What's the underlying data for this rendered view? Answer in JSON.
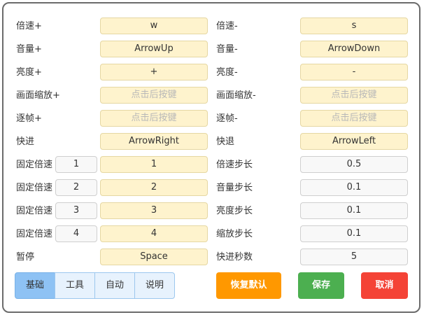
{
  "left_rows": [
    {
      "label": "倍速+",
      "key": "w",
      "placeholder": false
    },
    {
      "label": "音量+",
      "key": "ArrowUp",
      "placeholder": false
    },
    {
      "label": "亮度+",
      "key": "+",
      "placeholder": false
    },
    {
      "label": "画面缩放+",
      "key": "点击后按键",
      "placeholder": true
    },
    {
      "label": "逐帧+",
      "key": "点击后按键",
      "placeholder": true
    },
    {
      "label": "快进",
      "key": "ArrowRight",
      "placeholder": false
    },
    {
      "label": "固定倍速",
      "num": "1",
      "key": "1",
      "placeholder": false
    },
    {
      "label": "固定倍速",
      "num": "2",
      "key": "2",
      "placeholder": false
    },
    {
      "label": "固定倍速",
      "num": "3",
      "key": "3",
      "placeholder": false
    },
    {
      "label": "固定倍速",
      "num": "4",
      "key": "4",
      "placeholder": false
    },
    {
      "label": "暂停",
      "key": "Space",
      "placeholder": false
    }
  ],
  "right_rows": [
    {
      "label": "倍速-",
      "value": "s",
      "style": "yellow",
      "placeholder": false
    },
    {
      "label": "音量-",
      "value": "ArrowDown",
      "style": "yellow",
      "placeholder": false
    },
    {
      "label": "亮度-",
      "value": "-",
      "style": "yellow",
      "placeholder": false
    },
    {
      "label": "画面缩放-",
      "value": "点击后按键",
      "style": "yellow",
      "placeholder": true
    },
    {
      "label": "逐帧-",
      "value": "点击后按键",
      "style": "yellow",
      "placeholder": true
    },
    {
      "label": "快退",
      "value": "ArrowLeft",
      "style": "yellow",
      "placeholder": false
    },
    {
      "label": "倍速步长",
      "value": "0.5",
      "style": "grey",
      "placeholder": false
    },
    {
      "label": "音量步长",
      "value": "0.1",
      "style": "grey",
      "placeholder": false
    },
    {
      "label": "亮度步长",
      "value": "0.1",
      "style": "grey",
      "placeholder": false
    },
    {
      "label": "缩放步长",
      "value": "0.1",
      "style": "grey",
      "placeholder": false
    },
    {
      "label": "快进秒数",
      "value": "5",
      "style": "grey",
      "placeholder": false
    }
  ],
  "tabs": [
    {
      "label": "基础",
      "active": true
    },
    {
      "label": "工具",
      "active": false
    },
    {
      "label": "自动",
      "active": false
    },
    {
      "label": "说明",
      "active": false
    }
  ],
  "buttons": {
    "restore": {
      "label": "恢复默认",
      "color": "#ff9800"
    },
    "save": {
      "label": "保存",
      "color": "#4caf50"
    },
    "cancel": {
      "label": "取消",
      "color": "#f44336"
    }
  },
  "colors": {
    "key_field_bg": "#fef3cd",
    "value_field_bg": "#f8f8f8",
    "active_tab_bg": "#8ec2f4",
    "tab_bg": "#e7f2fd"
  }
}
